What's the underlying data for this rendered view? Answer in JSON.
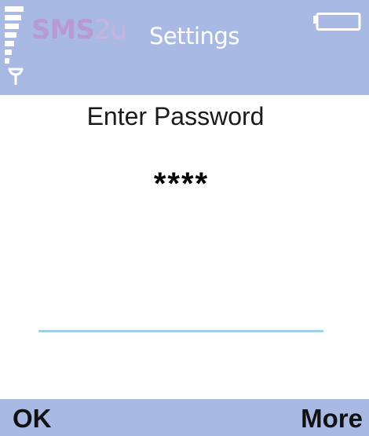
{
  "status_bar": {
    "logo_text_main": "SMS",
    "logo_text_suffix": "2u",
    "logo_tagline": "",
    "title": "Settings",
    "signal_icon": "signal-strength-icon",
    "antenna_icon": "antenna-icon",
    "battery_icon": "battery-icon",
    "background_color": "#a8b9e4"
  },
  "content": {
    "prompt": "Enter Password",
    "password_value": "****",
    "underline_color": "#9fd0e8"
  },
  "softkeys": {
    "left_label": "OK",
    "right_label": "More"
  }
}
